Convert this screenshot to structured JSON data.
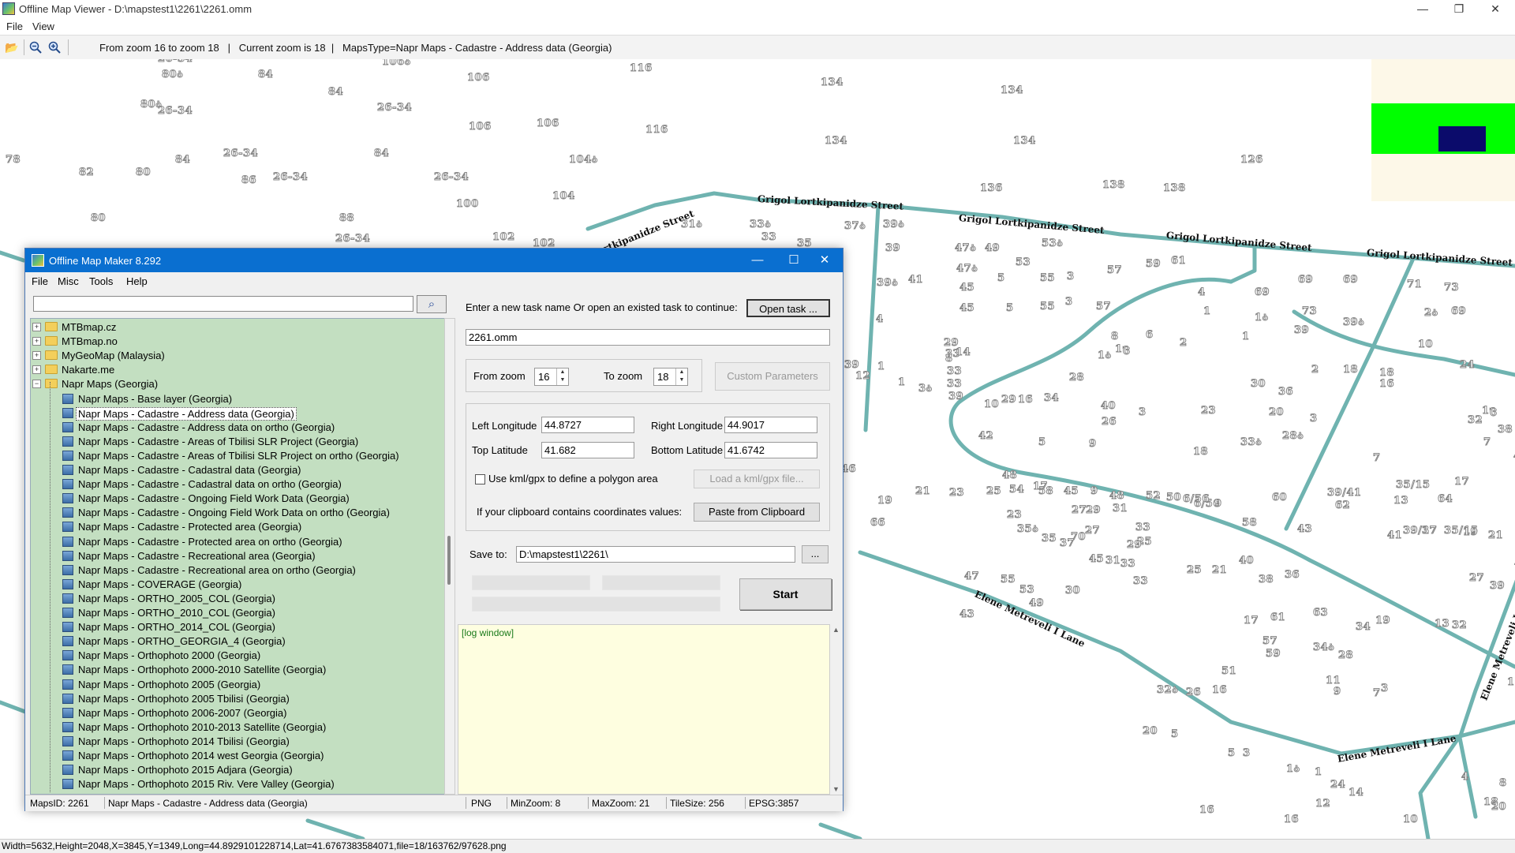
{
  "viewer": {
    "title": "Offline Map Viewer - D:\\mapstest1\\2261\\2261.omm",
    "menu": [
      "File",
      "View"
    ],
    "toolbar_text": "From zoom 16 to zoom 18   |   Current zoom is 18  |   MapsType=Napr Maps - Cadastre - Address data (Georgia)",
    "status": "Width=5632,Height=2048,X=3845,Y=1349,Long=44.8929101228714,Lat=41.6767383584071,file=18/163762/97628.png",
    "icons": [
      "open-folder-icon",
      "zoom-out-icon",
      "zoom-in-icon"
    ]
  },
  "map": {
    "streets": [
      "Grigol Lortkipanidze Street",
      "Grigol Lortkipanidze Street",
      "Grigol Lortkipanidze Street",
      "Grigol Lortkipanidze Street",
      "Lortkipanidze Street",
      "Elene Metreveli I Lane",
      "Elene Metreveli I Lane",
      "Elene Metreveli I Lane"
    ],
    "labels": [
      "26-34",
      "80ა",
      "84",
      "106ა",
      "116",
      "134",
      "134",
      "106",
      "84",
      "80ა",
      "26-34",
      "26-34",
      "106",
      "106",
      "116",
      "134",
      "134",
      "126",
      "78",
      "84",
      "26-34",
      "84",
      "104ა",
      "82",
      "80",
      "86",
      "26-34",
      "26-34",
      "136",
      "138",
      "138",
      "100",
      "104",
      "80",
      "88",
      "31ა",
      "33ა",
      "33",
      "35",
      "37ა",
      "39ა",
      "26-34",
      "102",
      "102",
      "39",
      "47ა",
      "49",
      "53ა",
      "47ა",
      "53",
      "59",
      "61",
      "5",
      "55",
      "3",
      "57",
      "45",
      "71",
      "73",
      "69",
      "69",
      "39ა",
      "41",
      "45",
      "5",
      "55",
      "3",
      "57",
      "4",
      "1",
      "69",
      "73",
      "2ა",
      "69",
      "39ა",
      "4",
      "10",
      "8",
      "6",
      "2",
      "1",
      "1ა",
      "39",
      "29",
      "33",
      "33",
      "33",
      "39",
      "39",
      "12",
      "1",
      "1",
      "3ა",
      "8",
      "14",
      "1ა",
      "1ც",
      "2",
      "18",
      "18",
      "24",
      "16",
      "28",
      "30",
      "36",
      "1ც",
      "10",
      "29",
      "16",
      "34",
      "40",
      "3",
      "23",
      "3",
      "20",
      "26",
      "32",
      "42",
      "5",
      "9",
      "33ა",
      "18",
      "28ა",
      "7",
      "7",
      "38",
      "44",
      "46",
      "48",
      "52",
      "6/56",
      "9",
      "39/41",
      "13",
      "35/15",
      "17",
      "19",
      "21",
      "23",
      "25",
      "54",
      "58",
      "45",
      "9",
      "48",
      "50",
      "6/56",
      "60",
      "62",
      "64",
      "66",
      "17",
      "27",
      "29",
      "31",
      "33",
      "58",
      "43",
      "41",
      "39/17",
      "37",
      "35/15",
      "19",
      "21",
      "23",
      "70",
      "35ა",
      "27",
      "25",
      "33",
      "35",
      "37",
      "45",
      "31",
      "33",
      "29",
      "25",
      "21",
      "40",
      "38",
      "36",
      "27",
      "39",
      "41",
      "43",
      "47",
      "55",
      "53",
      "49",
      "51",
      "61",
      "63",
      "34",
      "19",
      "17",
      "13",
      "32",
      "30",
      "57",
      "59",
      "34ა",
      "28",
      "11",
      "9",
      "7",
      "3",
      "1",
      "5",
      "32ა",
      "26",
      "16",
      "20",
      "5",
      "5",
      "3",
      "1ა",
      "1",
      "24",
      "16",
      "16",
      "14",
      "12",
      "10",
      "18",
      "18",
      "20",
      "8",
      "4",
      "22",
      "26ა",
      "2",
      "23",
      "25",
      "27",
      "18",
      "20",
      "16",
      "8"
    ]
  },
  "dialog": {
    "title": "Offline Map Maker 8.292",
    "menu": [
      "File",
      "Misc",
      "Tools",
      "Help"
    ],
    "search_value": "",
    "tree_top": [
      {
        "label": "MTBmap.cz",
        "expander": "+"
      },
      {
        "label": "MTBmap.no",
        "expander": "+"
      },
      {
        "label": "MyGeoMap (Malaysia)",
        "expander": "+"
      },
      {
        "label": "Nakarte.me",
        "expander": "+"
      },
      {
        "label": "Napr Maps (Georgia)",
        "expander": "−"
      }
    ],
    "tree_children": [
      "Napr Maps - Base layer (Georgia)",
      "Napr Maps - Cadastre - Address data (Georgia)",
      "Napr Maps - Cadastre - Address data on ortho (Georgia)",
      "Napr Maps - Cadastre - Areas of Tbilisi SLR Project (Georgia)",
      "Napr Maps - Cadastre - Areas of Tbilisi SLR Project on ortho (Georgia)",
      "Napr Maps - Cadastre - Cadastral data (Georgia)",
      "Napr Maps - Cadastre - Cadastral data on ortho (Georgia)",
      "Napr Maps - Cadastre - Ongoing Field Work Data (Georgia)",
      "Napr Maps - Cadastre - Ongoing Field Work Data on ortho (Georgia)",
      "Napr Maps - Cadastre - Protected area (Georgia)",
      "Napr Maps - Cadastre - Protected area on ortho (Georgia)",
      "Napr Maps - Cadastre - Recreational area (Georgia)",
      "Napr Maps - Cadastre - Recreational area on ortho (Georgia)",
      "Napr Maps - COVERAGE (Georgia)",
      "Napr Maps - ORTHO_2005_COL (Georgia)",
      "Napr Maps - ORTHO_2010_COL (Georgia)",
      "Napr Maps - ORTHO_2014_COL (Georgia)",
      "Napr Maps - ORTHO_GEORGIA_4 (Georgia)",
      "Napr Maps - Orthophoto 2000 (Georgia)",
      "Napr Maps - Orthophoto 2000-2010 Satellite (Georgia)",
      "Napr Maps - Orthophoto 2005 (Georgia)",
      "Napr Maps - Orthophoto 2005 Tbilisi (Georgia)",
      "Napr Maps - Orthophoto 2006-2007 (Georgia)",
      "Napr Maps - Orthophoto 2010-2013 Satellite (Georgia)",
      "Napr Maps - Orthophoto 2014 Tbilisi (Georgia)",
      "Napr Maps - Orthophoto 2014 west Georgia (Georgia)",
      "Napr Maps - Orthophoto 2015 Adjara (Georgia)",
      "Napr Maps - Orthophoto 2015 Riv. Vere Valley (Georgia)"
    ],
    "selected_index": 1,
    "task_prompt": "Enter a new task name Or open an existed task to continue:",
    "open_task_label": "Open task ...",
    "task_name": "2261.omm",
    "from_zoom_label": "From zoom",
    "from_zoom": "16",
    "to_zoom_label": "To zoom",
    "to_zoom": "18",
    "custom_params_label": "Custom Parameters",
    "left_lon_label": "Left Longitude",
    "left_lon": "44.8727",
    "right_lon_label": "Right Longitude",
    "right_lon": "44.9017",
    "top_lat_label": "Top Latitude",
    "top_lat": "41.682",
    "bottom_lat_label": "Bottom Latitude",
    "bottom_lat": "41.6742",
    "kml_label": "Use kml/gpx to define a polygon area",
    "kml_checked": false,
    "load_kml_label": "Load a kml/gpx file...",
    "clipboard_prompt": "If your clipboard contains coordinates values:",
    "paste_label": "Paste from Clipboard",
    "save_to_label": "Save to:",
    "save_to": "D:\\mapstest1\\2261\\",
    "browse_label": "...",
    "start_label": "Start",
    "log_text": "[log window]",
    "status": {
      "maps_id": "MapsID: 2261",
      "maps_name": "Napr Maps - Cadastre - Address data (Georgia)",
      "format": "PNG",
      "min_zoom": "MinZoom: 8",
      "max_zoom": "MaxZoom: 21",
      "tile_size": "TileSize: 256",
      "epsg": "EPSG:3857"
    }
  },
  "colors": {
    "road": "#6fb3b0",
    "title_blue": "#0a6fd0",
    "tree_bg": "#c3dfc1",
    "log_bg": "#fefee0",
    "minimap_green": "#00ff00",
    "minimap_blue": "#0b0b6b"
  }
}
